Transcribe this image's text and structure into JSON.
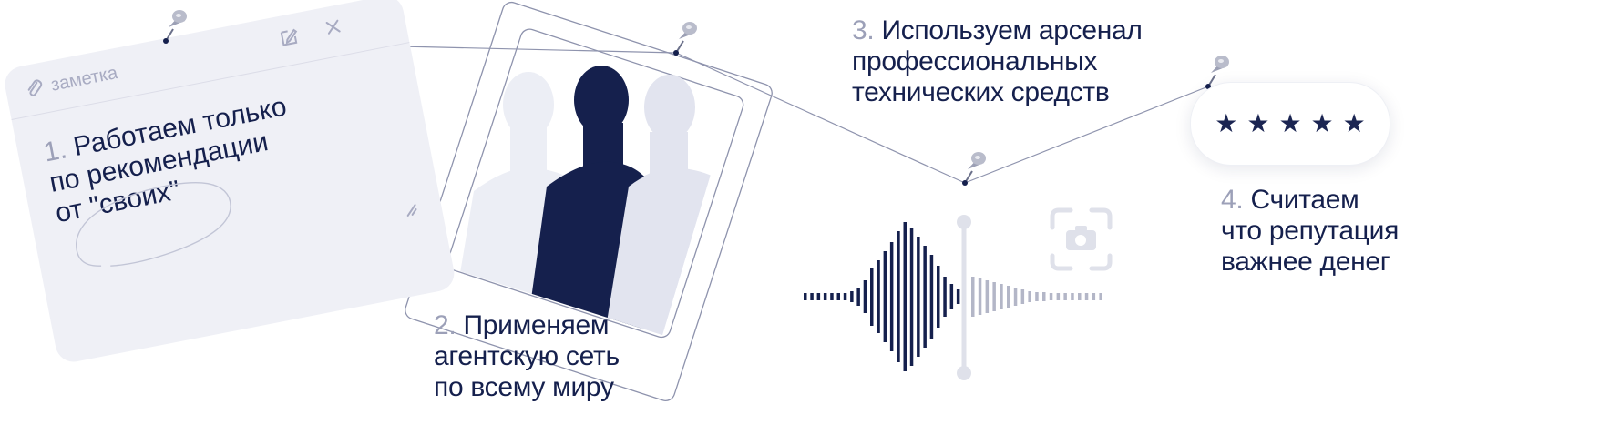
{
  "note": {
    "tab_label": "заметка",
    "step_num": "1.",
    "step_text_line1": "Работаем только",
    "step_text_line2": "по рекомендации",
    "step_text_line3": "от \"своих\""
  },
  "steps": [
    {
      "num": "2.",
      "lines": [
        "Применяем",
        "агентскую сеть",
        "по всему миру"
      ]
    },
    {
      "num": "3.",
      "lines": [
        "Используем арсенал",
        "профессиональных",
        "технических средств"
      ]
    },
    {
      "num": "4.",
      "lines": [
        "Считаем",
        "что репутация",
        "важнее денег"
      ]
    }
  ],
  "rating": {
    "stars": 5
  },
  "colors": {
    "navy": "#15204d",
    "muted": "#9ca0b8",
    "note_bg": "#eff0f6",
    "pin": "#a7abb8"
  },
  "icons": [
    "pushpin-icon",
    "paperclip-icon",
    "edit-icon",
    "close-icon",
    "resize-icon",
    "camera-icon",
    "star-icon"
  ]
}
